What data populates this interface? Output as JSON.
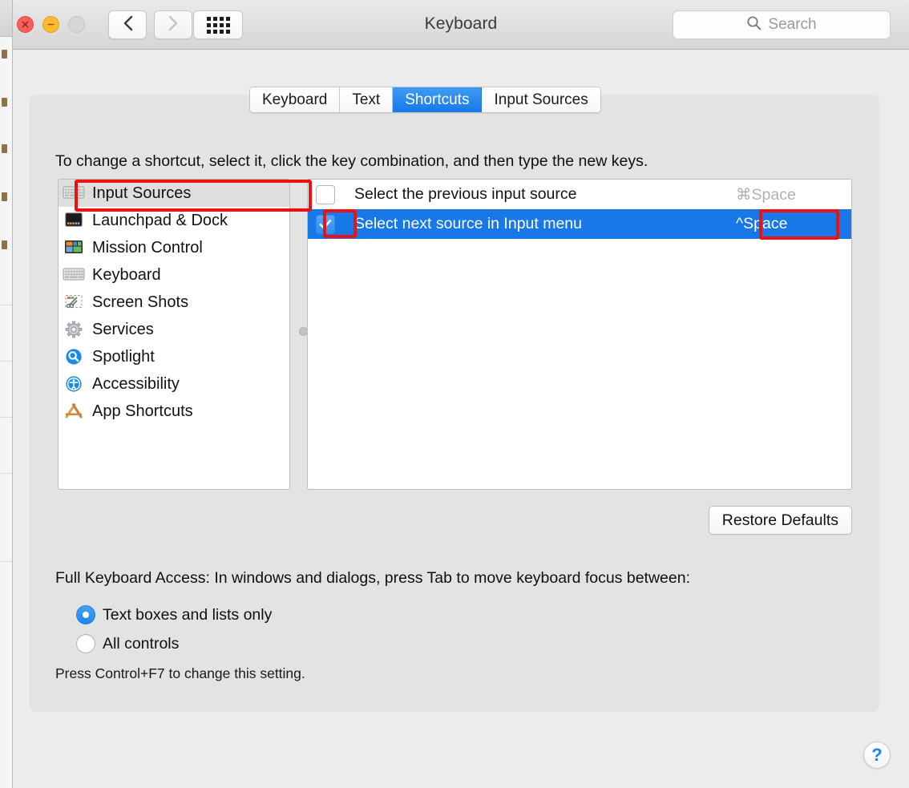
{
  "window": {
    "title": "Keyboard",
    "traffic_lights": [
      "close-button",
      "minimize-button",
      "zoom-button"
    ],
    "nav_back": "back-icon",
    "nav_forward": "forward-icon",
    "show_all": "grid-icon"
  },
  "search": {
    "placeholder": "Search",
    "icon": "search-icon",
    "value": ""
  },
  "tabs": [
    {
      "label": "Keyboard",
      "selected": false
    },
    {
      "label": "Text",
      "selected": false
    },
    {
      "label": "Shortcuts",
      "selected": true
    },
    {
      "label": "Input Sources",
      "selected": false
    }
  ],
  "instruction": "To change a shortcut, select it, click the key combination, and then type the new keys.",
  "categories": [
    {
      "label": "Input Sources",
      "icon": "keyboard-icon",
      "selected": true
    },
    {
      "label": "Launchpad & Dock",
      "icon": "launchpad-dock-icon",
      "selected": false
    },
    {
      "label": "Mission Control",
      "icon": "mission-control-icon",
      "selected": false
    },
    {
      "label": "Keyboard",
      "icon": "keyboard-icon",
      "selected": false
    },
    {
      "label": "Screen Shots",
      "icon": "screenshot-icon",
      "selected": false
    },
    {
      "label": "Services",
      "icon": "gear-icon",
      "selected": false
    },
    {
      "label": "Spotlight",
      "icon": "spotlight-icon",
      "selected": false
    },
    {
      "label": "Accessibility",
      "icon": "accessibility-icon",
      "selected": false
    },
    {
      "label": "App Shortcuts",
      "icon": "app-shortcuts-icon",
      "selected": false
    }
  ],
  "shortcuts": [
    {
      "label": "Select the previous input source",
      "key": "⌘Space",
      "checked": false,
      "selected": false
    },
    {
      "label": "Select next source in Input menu",
      "key": "^Space",
      "checked": true,
      "selected": true
    }
  ],
  "restore_defaults_label": "Restore Defaults",
  "full_keyboard_access": {
    "title": "Full Keyboard Access: In windows and dialogs, press Tab to move keyboard focus between:",
    "options": [
      {
        "label": "Text boxes and lists only",
        "selected": true
      },
      {
        "label": "All controls",
        "selected": false
      }
    ],
    "note": "Press Control+F7 to change this setting."
  },
  "help_label": "?",
  "colors": {
    "accent_blue": "#1878e8",
    "annotation_red": "#ee1111",
    "window_bg": "#ececec",
    "panel_bg": "#e3e3e3",
    "selected_row_text": "#ffffff",
    "disabled_key_text": "#b0b0b0"
  }
}
